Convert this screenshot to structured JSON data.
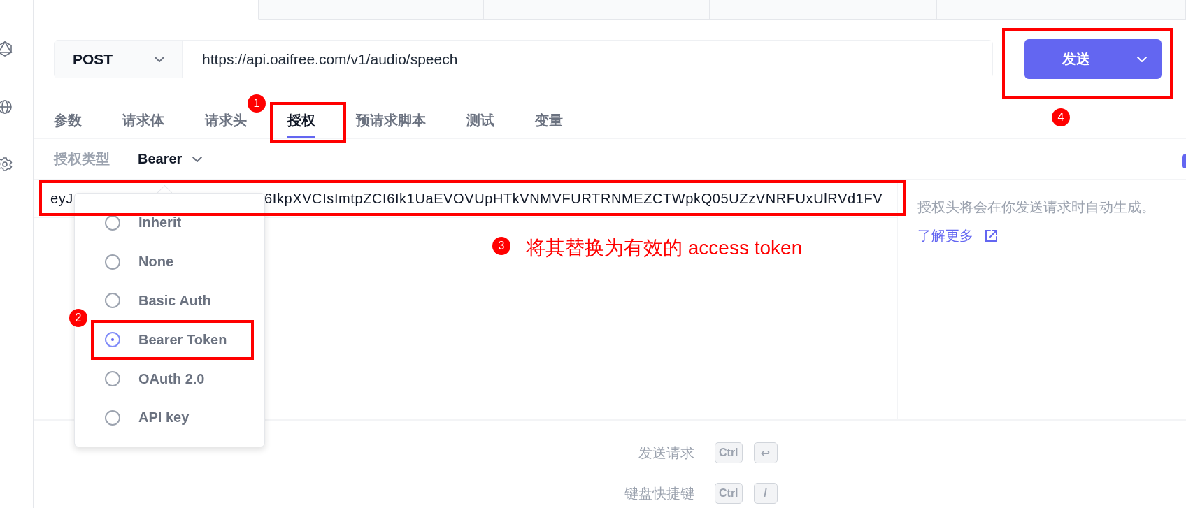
{
  "request_tabs": [
    {
      "selected": true
    },
    {
      "selected": false
    },
    {
      "selected": false
    },
    {
      "selected": false
    },
    {
      "selected": false
    },
    {
      "selected": false
    }
  ],
  "request": {
    "method": "POST",
    "url": "https://api.oaifree.com/v1/audio/speech",
    "send_label": "发送"
  },
  "tabs": [
    {
      "label": "参数",
      "selected": false
    },
    {
      "label": "请求体",
      "selected": false
    },
    {
      "label": "请求头",
      "selected": false
    },
    {
      "label": "授权",
      "selected": true
    },
    {
      "label": "预请求脚本",
      "selected": false
    },
    {
      "label": "测试",
      "selected": false
    },
    {
      "label": "变量",
      "selected": false
    }
  ],
  "auth": {
    "type_label": "授权类型",
    "type_value": "Bearer",
    "token_start": "eyJ",
    "token_end": "6IkpXVCIsImtpZCI6Ik1UaEVOVUpHTkVNMVFURTRNMEZCTWpkQ05UZzVNRFUxUlRVd1FV"
  },
  "auth_menu": [
    {
      "label": "Inherit",
      "selected": false
    },
    {
      "label": "None",
      "selected": false
    },
    {
      "label": "Basic Auth",
      "selected": false
    },
    {
      "label": "Bearer Token",
      "selected": true
    },
    {
      "label": "OAuth 2.0",
      "selected": false
    },
    {
      "label": "API key",
      "selected": false
    }
  ],
  "help": {
    "text": "授权头将会在你发送请求时自动生成。",
    "link": "了解更多"
  },
  "shortcuts": [
    {
      "label": "发送请求",
      "keys": [
        "Ctrl",
        "↩"
      ]
    },
    {
      "label": "键盘快捷键",
      "keys": [
        "Ctrl",
        "/"
      ]
    }
  ],
  "annotations": [
    {
      "number": "1"
    },
    {
      "number": "2"
    },
    {
      "number": "3",
      "text": "将其替换为有效的 access token"
    },
    {
      "number": "4"
    }
  ]
}
